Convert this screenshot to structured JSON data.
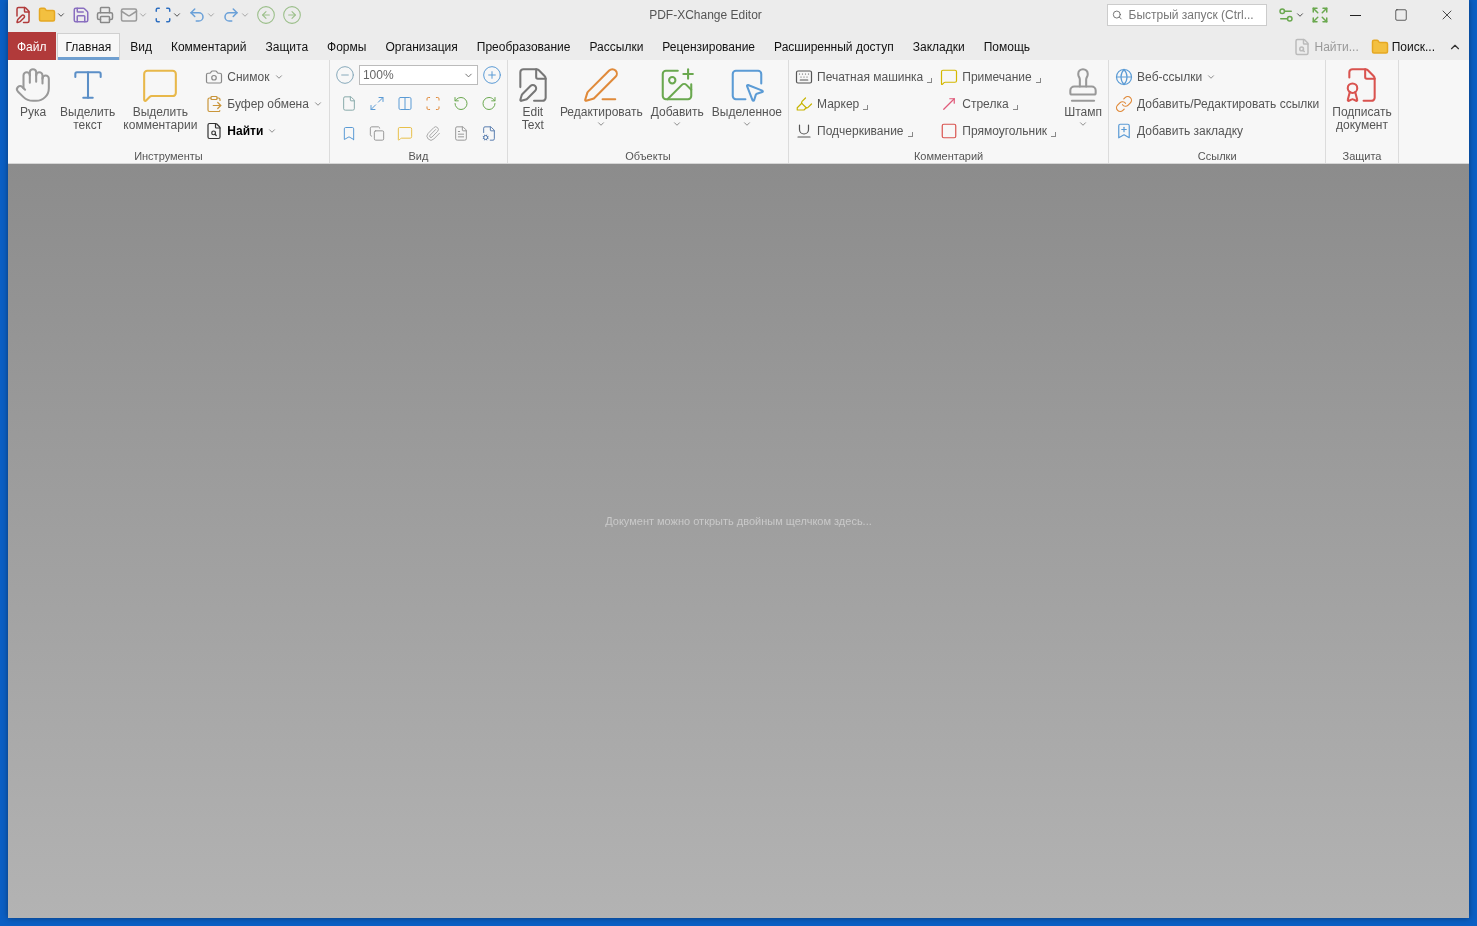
{
  "window": {
    "title": "PDF-XChange Editor"
  },
  "quick_launch": {
    "placeholder": "Быстрый запуск (Ctrl..."
  },
  "menu_tabs": [
    {
      "label": "Файл",
      "kind": "file"
    },
    {
      "label": "Главная",
      "kind": "tab",
      "selected": true
    },
    {
      "label": "Вид",
      "kind": "tab",
      "selected": false
    },
    {
      "label": "Комментарий",
      "kind": "tab",
      "selected": false
    },
    {
      "label": "Защита",
      "kind": "tab",
      "selected": false
    },
    {
      "label": "Формы",
      "kind": "tab",
      "selected": false
    },
    {
      "label": "Организация",
      "kind": "tab",
      "selected": false
    },
    {
      "label": "Преобразование",
      "kind": "tab",
      "selected": false
    },
    {
      "label": "Рассылки",
      "kind": "tab",
      "selected": false
    },
    {
      "label": "Рецензирование",
      "kind": "tab",
      "selected": false
    },
    {
      "label": "Расширенный доступ",
      "kind": "tab",
      "selected": false
    },
    {
      "label": "Закладки",
      "kind": "tab",
      "selected": false
    },
    {
      "label": "Помощь",
      "kind": "tab",
      "selected": false
    }
  ],
  "search_tools": [
    {
      "label": "Найти...",
      "disabled": true
    },
    {
      "label": "Поиск...",
      "disabled": false
    }
  ],
  "ribbon": {
    "groups": [
      {
        "label": "Инструменты",
        "items": [
          {
            "kind": "large",
            "label": "Рука",
            "dropdown": false
          },
          {
            "kind": "large",
            "label": "Выделить текст",
            "dropdown": false
          },
          {
            "kind": "large",
            "label": "Выделить комментарии",
            "dropdown": false
          },
          {
            "kind": "column",
            "items": [
              {
                "label": "Снимок",
                "dropdown": true,
                "corner": false,
                "emphasized": false
              },
              {
                "label": "Буфер обмена",
                "dropdown": true,
                "corner": false,
                "emphasized": false
              },
              {
                "label": "Найти",
                "dropdown": true,
                "corner": false,
                "emphasized": true
              }
            ]
          }
        ]
      },
      {
        "label": "Вид",
        "items": [
          {
            "kind": "zoom",
            "value": "100%"
          },
          {
            "kind": "icons"
          }
        ]
      },
      {
        "label": "Объекты",
        "items": [
          {
            "kind": "large",
            "label": "Edit Text",
            "dropdown": false
          },
          {
            "kind": "large",
            "label": "Редактировать",
            "dropdown": true
          },
          {
            "kind": "large",
            "label": "Добавить",
            "dropdown": true
          },
          {
            "kind": "large",
            "label": "Выделенное",
            "dropdown": true
          }
        ]
      },
      {
        "label": "Комментарий",
        "items": [
          {
            "kind": "column",
            "items": [
              {
                "label": "Печатная машинка",
                "dropdown": false,
                "corner": true,
                "emphasized": false
              },
              {
                "label": "Маркер",
                "dropdown": false,
                "corner": true,
                "emphasized": false
              },
              {
                "label": "Подчеркивание",
                "dropdown": false,
                "corner": true,
                "emphasized": false
              }
            ]
          },
          {
            "kind": "column",
            "items": [
              {
                "label": "Примечание",
                "dropdown": false,
                "corner": true,
                "emphasized": false
              },
              {
                "label": "Стрелка",
                "dropdown": false,
                "corner": true,
                "emphasized": false
              },
              {
                "label": "Прямоугольник",
                "dropdown": false,
                "corner": true,
                "emphasized": false
              }
            ]
          },
          {
            "kind": "large",
            "label": "Штамп",
            "dropdown": true
          }
        ]
      },
      {
        "label": "Ссылки",
        "items": [
          {
            "kind": "column",
            "items": [
              {
                "label": "Веб-ссылки",
                "dropdown": true,
                "corner": false,
                "emphasized": false
              },
              {
                "label": "Добавить/Редактировать ссылки",
                "dropdown": false,
                "corner": false,
                "emphasized": false
              },
              {
                "label": "Добавить закладку",
                "dropdown": false,
                "corner": false,
                "emphasized": false
              }
            ]
          }
        ]
      },
      {
        "label": "Защита",
        "items": [
          {
            "kind": "large",
            "label": "Подписать документ",
            "dropdown": false
          }
        ]
      }
    ]
  },
  "document_area": {
    "hint": "Документ можно открыть двойным щелчком здесь..."
  }
}
